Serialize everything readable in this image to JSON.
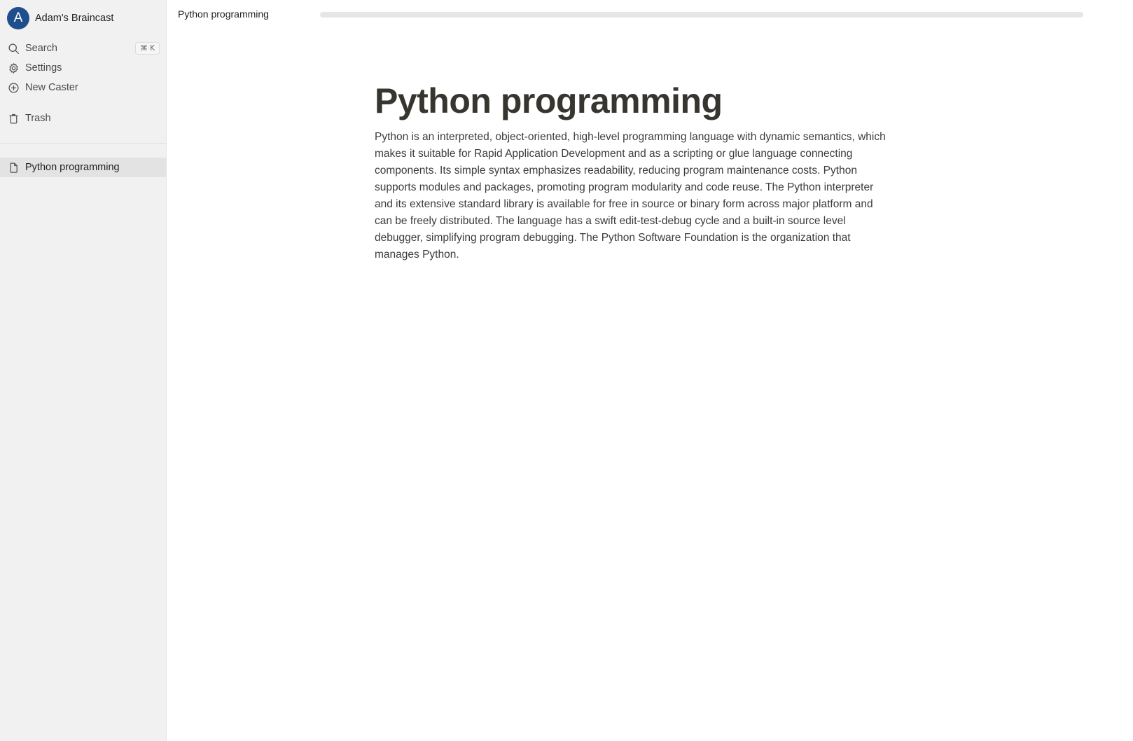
{
  "sidebar": {
    "workspace": {
      "avatar_letter": "A",
      "name": "Adam's Braincast"
    },
    "nav": {
      "search": {
        "label": "Search",
        "shortcut": "⌘ K",
        "icon": "search-icon"
      },
      "settings": {
        "label": "Settings",
        "icon": "gear-icon"
      },
      "new_caster": {
        "label": "New Caster",
        "icon": "plus-circle-icon"
      },
      "trash": {
        "label": "Trash",
        "icon": "trash-icon"
      }
    },
    "pages": [
      {
        "label": "Python programming",
        "icon": "document-icon",
        "selected": true
      }
    ]
  },
  "topbar": {
    "title": "Python programming",
    "progress": 0
  },
  "document": {
    "title": "Python programming",
    "body": "Python is an interpreted, object-oriented, high-level programming language with dynamic semantics, which makes it suitable for Rapid Application Development and as a scripting or glue language connecting components. Its simple syntax emphasizes readability, reducing program maintenance costs. Python supports modules and packages, promoting program modularity and code reuse. The Python interpreter and its extensive standard library is available for free in source or binary form across major platform and can be freely distributed. The language has a swift edit-test-debug cycle and a built-in source level debugger, simplifying program debugging. The Python Software Foundation is the organization that manages Python."
  },
  "colors": {
    "avatar_bg": "#1f4e8c",
    "sidebar_bg": "#f1f1f1",
    "selected_bg": "#e3e3e3",
    "progress_track": "#e6e6e9"
  }
}
